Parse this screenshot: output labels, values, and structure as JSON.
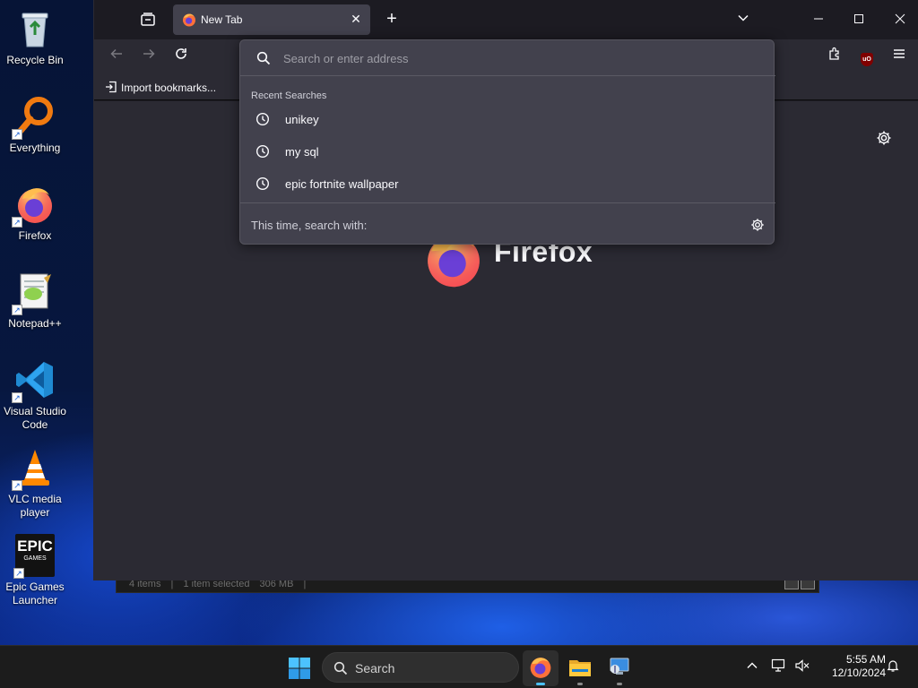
{
  "desktop": {
    "icons": [
      {
        "label": "Recycle Bin"
      },
      {
        "label": "Everything"
      },
      {
        "label": "Firefox"
      },
      {
        "label": "Notepad++"
      },
      {
        "label": "Visual Studio Code"
      },
      {
        "label": "VLC media player"
      },
      {
        "label": "Epic Games Launcher"
      }
    ],
    "epic_logo_text": "EPIC",
    "epic_logo_sub": "GAMES"
  },
  "explorer_behind": {
    "items": "4 items",
    "selected": "1 item selected",
    "size": "306 MB"
  },
  "browser": {
    "tab_title": "New Tab",
    "bookmark_import": "Import bookmarks...",
    "wordmark": "Firefox",
    "urlbar": {
      "placeholder": "Search or enter address",
      "value": "",
      "recent_header": "Recent Searches",
      "recent": [
        "unikey",
        "my sql",
        "epic fortnite wallpaper"
      ],
      "footer": "This time, search with:"
    },
    "extension_badge": "uO"
  },
  "taskbar": {
    "search_label": "Search",
    "time": "5:55 AM",
    "date": "12/10/2024"
  },
  "colors": {
    "ff_bg": "#2b2a33",
    "urlbar_bg": "#42414d",
    "accent": "#4cc2ff"
  }
}
